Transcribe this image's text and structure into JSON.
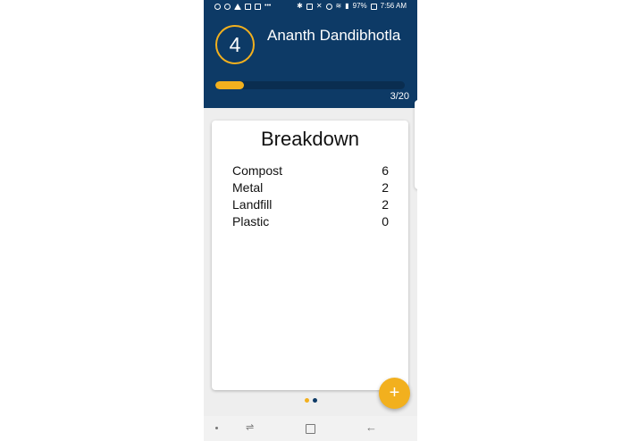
{
  "status_bar": {
    "battery": "97%",
    "time": "7:56 AM"
  },
  "header": {
    "level": "4",
    "user_name": "Ananth Dandibhotla",
    "progress_fraction": 0.15,
    "progress_text": "3/20"
  },
  "card": {
    "title": "Breakdown",
    "items": [
      {
        "label": "Compost",
        "value": "6"
      },
      {
        "label": "Metal",
        "value": "2"
      },
      {
        "label": "Landfill",
        "value": "2"
      },
      {
        "label": "Plastic",
        "value": "0"
      }
    ]
  },
  "fab": {
    "icon": "plus-icon",
    "label": "+"
  },
  "pager": {
    "count": 2,
    "active_index": 0
  },
  "colors": {
    "header_bg": "#0d3a66",
    "accent": "#f2b01e"
  }
}
